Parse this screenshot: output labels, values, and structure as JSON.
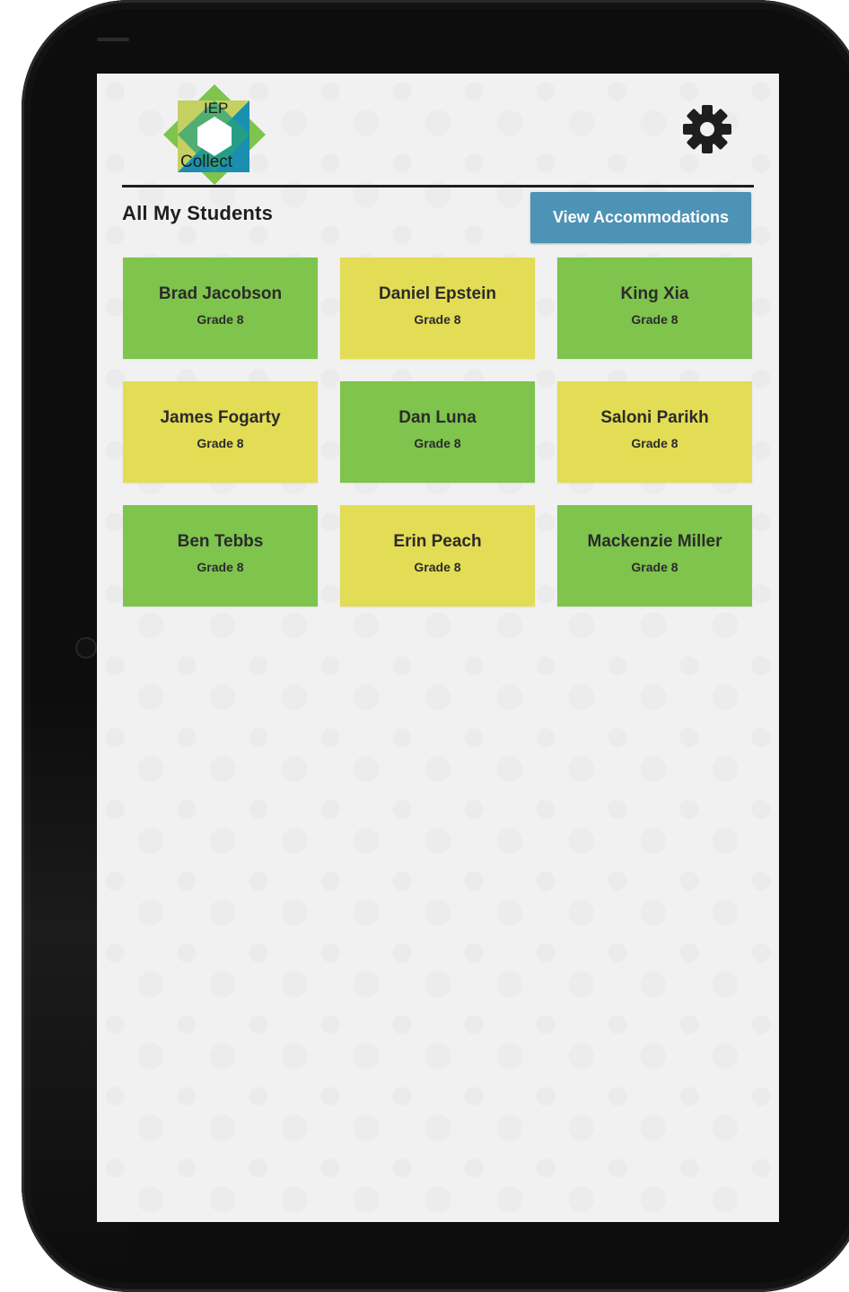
{
  "app": {
    "logo_top": "IEP",
    "logo_bottom": "Collect"
  },
  "header": {
    "title": "All My Students",
    "accommodations_button": "View Accommodations",
    "settings_icon": "gear-icon"
  },
  "colors": {
    "green": "#7ec44d",
    "yellow": "#e3dc55",
    "button": "#4d93b5"
  },
  "students": [
    {
      "name": "Brad Jacobson",
      "grade": "Grade 8",
      "color": "green"
    },
    {
      "name": "Daniel Epstein",
      "grade": "Grade 8",
      "color": "yellow"
    },
    {
      "name": "King Xia",
      "grade": "Grade 8",
      "color": "green"
    },
    {
      "name": "James Fogarty",
      "grade": "Grade 8",
      "color": "yellow"
    },
    {
      "name": "Dan Luna",
      "grade": "Grade 8",
      "color": "green"
    },
    {
      "name": "Saloni Parikh",
      "grade": "Grade 8",
      "color": "yellow"
    },
    {
      "name": "Ben Tebbs",
      "grade": "Grade 8",
      "color": "green"
    },
    {
      "name": "Erin Peach",
      "grade": "Grade 8",
      "color": "yellow"
    },
    {
      "name": "Mackenzie Miller",
      "grade": "Grade 8",
      "color": "green"
    }
  ]
}
